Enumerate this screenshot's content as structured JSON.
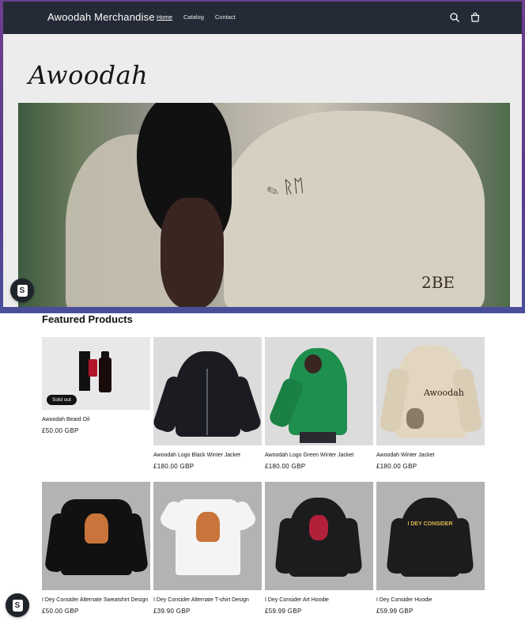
{
  "header": {
    "brand": "Awoodah Merchandise",
    "nav": [
      {
        "label": "Home",
        "active": true
      },
      {
        "label": "Catalog",
        "active": false
      },
      {
        "label": "Contact",
        "active": false
      }
    ],
    "icons": [
      "search-icon",
      "cart-icon"
    ],
    "background": "#252b36"
  },
  "hero": {
    "logo_text": "Awoodah",
    "jacket_text": "2BE"
  },
  "featured": {
    "title": "Featured Products",
    "products": [
      {
        "name": "Awoodah Beard Oil",
        "price": "£50.00 GBP",
        "badge": "Sold out",
        "label": "AWOODAH"
      },
      {
        "name": "Awoodah Logo Black Winter Jacket",
        "price": "£180.00 GBP"
      },
      {
        "name": "Awoodah Logo Green Winter Jacket",
        "price": "£180.00 GBP"
      },
      {
        "name": "Awoodah Winter Jacket",
        "price": "£180.00 GBP",
        "label": "Awoodah"
      },
      {
        "name": "I Dey Consider Alternate Sweatshirt Design",
        "price": "£50.00 GBP"
      },
      {
        "name": "I Dey Consider Alternate T-shirt Design",
        "price": "£39.90 GBP"
      },
      {
        "name": "I Dey Consider Art Hoodie",
        "price": "£59.99 GBP"
      },
      {
        "name": "I Dey Consider Hoodie",
        "price": "£59.99 GBP",
        "label": "I DEY CONSIDER"
      }
    ]
  },
  "colors": {
    "frame": "#5a3a8c",
    "text": "#121212",
    "jacket_green": "#1e8f4e",
    "jacket_black": "#1a1c22"
  }
}
